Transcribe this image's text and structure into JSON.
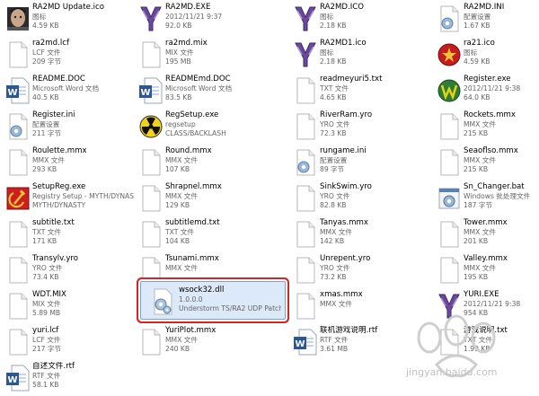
{
  "files": [
    {
      "name": "RA2MD Update.ico",
      "line2": "图标",
      "line3": "4.59 KB",
      "icon": "face-icon"
    },
    {
      "name": "RA2MD.EXE",
      "line2": "2012/11/21 9:37",
      "line3": "92.0 KB",
      "icon": "yuri-logo-icon"
    },
    {
      "name": "RA2MD.ICO",
      "line2": "图标",
      "line3": "2.18 KB",
      "icon": "yuri-logo-icon"
    },
    {
      "name": "RA2MD.INI",
      "line2": "配置设置",
      "line3": "1.67 KB",
      "icon": "settings-file-icon"
    },
    {
      "name": "ra2md.lcf",
      "line2": "LCF 文件",
      "line3": "209 字节",
      "icon": "blank-file-icon"
    },
    {
      "name": "ra2md.mix",
      "line2": "MIX 文件",
      "line3": "195 MB",
      "icon": "blank-file-icon"
    },
    {
      "name": "RA2MD1.ico",
      "line2": "图标",
      "line3": "2.18 KB",
      "icon": "yuri-logo-icon"
    },
    {
      "name": "ra21.ico",
      "line2": "图标",
      "line3": "4.59 KB",
      "icon": "soviet-emblem-icon"
    },
    {
      "name": "README.DOC",
      "line2": "Microsoft Word 文档",
      "line3": "40.5 KB",
      "icon": "word-doc-icon"
    },
    {
      "name": "READMEmd.DOC",
      "line2": "Microsoft Word 文档",
      "line3": "83.5 KB",
      "icon": "word-doc-icon"
    },
    {
      "name": "readmeyuri5.txt",
      "line2": "TXT 文件",
      "line3": "4.65 KB",
      "icon": "blank-file-icon"
    },
    {
      "name": "Register.exe",
      "line2": "2012/11/21 9:38",
      "line3": "64.0 KB",
      "icon": "green-w-logo-icon"
    },
    {
      "name": "Register.ini",
      "line2": "配置设置",
      "line3": "211 字节",
      "icon": "settings-file-icon"
    },
    {
      "name": "RegSetup.exe",
      "line2": "regsetup",
      "line3": "CLASS/BACKLASH",
      "icon": "radiation-icon"
    },
    {
      "name": "RiverRam.yro",
      "line2": "YRO 文件",
      "line3": "72.3 KB",
      "icon": "blank-file-icon"
    },
    {
      "name": "Rockets.mmx",
      "line2": "MMX 文件",
      "line3": "215 KB",
      "icon": "blank-file-icon"
    },
    {
      "name": "Roulette.mmx",
      "line2": "MMX 文件",
      "line3": "293 KB",
      "icon": "blank-file-icon"
    },
    {
      "name": "Round.mmx",
      "line2": "MMX 文件",
      "line3": "107 KB",
      "icon": "blank-file-icon"
    },
    {
      "name": "rungame.ini",
      "line2": "配置设置",
      "line3": "89 字节",
      "icon": "settings-file-icon"
    },
    {
      "name": "Seaoflso.mmx",
      "line2": "MMX 文件",
      "line3": "215 KB",
      "icon": "blank-file-icon"
    },
    {
      "name": "SetupReg.exe",
      "line2": "Registry Setup - MYTH/DYNAS...",
      "line3": "MYTH/DYNASTY",
      "icon": "hammer-sickle-icon"
    },
    {
      "name": "Shrapnel.mmx",
      "line2": "MMX 文件",
      "line3": "129 KB",
      "icon": "blank-file-icon"
    },
    {
      "name": "SinkSwim.yro",
      "line2": "YRO 文件",
      "line3": "82.8 KB",
      "icon": "blank-file-icon"
    },
    {
      "name": "Sn_Changer.bat",
      "line2": "Windows 批处理文件",
      "line3": "187 字节",
      "icon": "batch-gear-icon"
    },
    {
      "name": "subtitle.txt",
      "line2": "TXT 文件",
      "line3": "171 KB",
      "icon": "blank-file-icon"
    },
    {
      "name": "subtitlemd.txt",
      "line2": "TXT 文件",
      "line3": "104 KB",
      "icon": "blank-file-icon"
    },
    {
      "name": "Tanyas.mmx",
      "line2": "MMX 文件",
      "line3": "142 KB",
      "icon": "blank-file-icon"
    },
    {
      "name": "Tower.mmx",
      "line2": "MMX 文件",
      "line3": "201 KB",
      "icon": "blank-file-icon"
    },
    {
      "name": "Transylv.yro",
      "line2": "YRO 文件",
      "line3": "73.4 KB",
      "icon": "blank-file-icon"
    },
    {
      "name": "Tsunami.mmx",
      "line2": "MMX 文件",
      "line3": "",
      "icon": "blank-file-icon"
    },
    {
      "name": "Unrepent.yro",
      "line2": "YRO 文件",
      "line3": "73.2 KB",
      "icon": "blank-file-icon"
    },
    {
      "name": "Valley.mmx",
      "line2": "MMX 文件",
      "line3": "195 KB",
      "icon": "blank-file-icon"
    },
    {
      "name": "WDT.MIX",
      "line2": "MIX 文件",
      "line3": "5.89 MB",
      "icon": "blank-file-icon"
    },
    {
      "name": "wsock32.dll",
      "line2": "1.0.0.0",
      "line3": "Understorm TS/RA2 UDP Patch",
      "icon": "dll-gear-icon",
      "selected": true
    },
    {
      "name": "xmas.mmx",
      "line2": "MMX 文件",
      "line3": "",
      "icon": "blank-file-icon"
    },
    {
      "name": "YURI.EXE",
      "line2": "2012/11/21 9:38",
      "line3": "954 KB",
      "icon": "yuri-logo-icon"
    },
    {
      "name": "yuri.lcf",
      "line2": "LCF 文件",
      "line3": "217 字节",
      "icon": "blank-file-icon"
    },
    {
      "name": "YuriPlot.mmx",
      "line2": "MMX 文件",
      "line3": "240 KB",
      "icon": "blank-file-icon"
    },
    {
      "name": "联机游戏说明.rtf",
      "line2": "RTF 文件",
      "line3": "3.61 MB",
      "icon": "word-doc-icon"
    },
    {
      "name": "游戏说明.txt",
      "line2": "TXT 文件",
      "line3": "1.99 KB",
      "icon": "blank-file-icon"
    },
    {
      "name": "自述文件.rtf",
      "line2": "RTF 文件",
      "line3": "58.1 KB",
      "icon": "word-doc-icon"
    }
  ],
  "watermark": {
    "text": "jingyan.baidu.com"
  }
}
